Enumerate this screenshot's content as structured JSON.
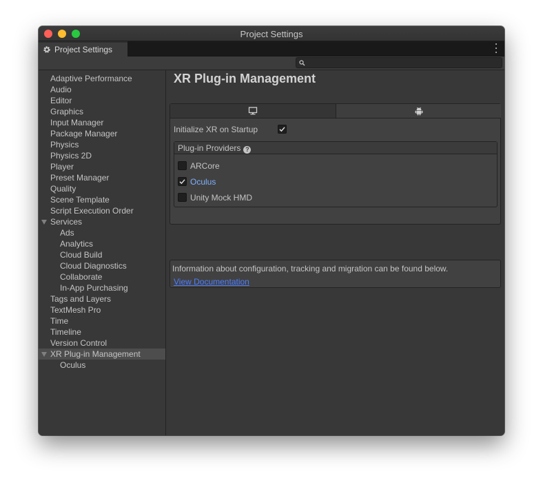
{
  "window": {
    "title": "Project Settings"
  },
  "tab": {
    "label": "Project Settings",
    "icon": "gear-icon"
  },
  "search": {
    "placeholder": "",
    "value": ""
  },
  "sidebar": {
    "items": [
      {
        "label": "Adaptive Performance"
      },
      {
        "label": "Audio"
      },
      {
        "label": "Editor"
      },
      {
        "label": "Graphics"
      },
      {
        "label": "Input Manager"
      },
      {
        "label": "Package Manager"
      },
      {
        "label": "Physics"
      },
      {
        "label": "Physics 2D"
      },
      {
        "label": "Player"
      },
      {
        "label": "Preset Manager"
      },
      {
        "label": "Quality"
      },
      {
        "label": "Scene Template"
      },
      {
        "label": "Script Execution Order"
      },
      {
        "label": "Services",
        "expanded": true
      },
      {
        "label": "Ads"
      },
      {
        "label": "Analytics"
      },
      {
        "label": "Cloud Build"
      },
      {
        "label": "Cloud Diagnostics"
      },
      {
        "label": "Collaborate"
      },
      {
        "label": "In-App Purchasing"
      },
      {
        "label": "Tags and Layers"
      },
      {
        "label": "TextMesh Pro"
      },
      {
        "label": "Time"
      },
      {
        "label": "Timeline"
      },
      {
        "label": "Version Control"
      },
      {
        "label": "XR Plug-in Management",
        "expanded": true,
        "selected": true
      },
      {
        "label": "Oculus"
      }
    ]
  },
  "main": {
    "title": "XR Plug-in Management",
    "platform_tabs": [
      {
        "icon": "desktop-icon",
        "active": false
      },
      {
        "icon": "android-icon",
        "active": true
      }
    ],
    "init_on_startup": {
      "label": "Initialize XR on Startup",
      "checked": true
    },
    "providers": {
      "header": "Plug-in Providers",
      "items": [
        {
          "label": "ARCore",
          "checked": false
        },
        {
          "label": "Oculus",
          "checked": true
        },
        {
          "label": "Unity Mock HMD",
          "checked": false
        }
      ]
    },
    "info": {
      "text": "Information about configuration, tracking and migration can be found below.",
      "link": "View Documentation"
    }
  },
  "colors": {
    "link": "#4c7eff",
    "checked_label": "#7fb0ff",
    "selected_row": "#4d4d4d"
  }
}
